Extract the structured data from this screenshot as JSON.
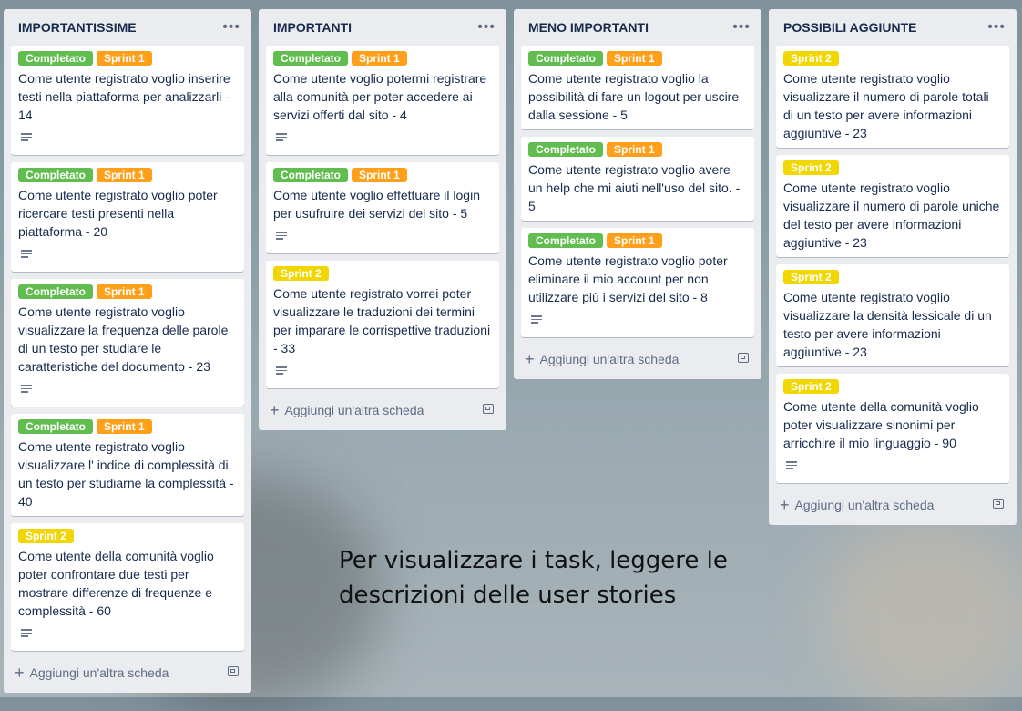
{
  "lists": [
    {
      "title": "IMPORTANTISSIME",
      "cards": [
        {
          "labels": [
            {
              "text": "Completato",
              "color": "#61bd4f"
            },
            {
              "text": "Sprint 1",
              "color": "#ff9f1a"
            }
          ],
          "text": "Come utente registrato voglio inserire testi nella piattaforma per analizzarli - 14",
          "has_description": true
        },
        {
          "labels": [
            {
              "text": "Completato",
              "color": "#61bd4f"
            },
            {
              "text": "Sprint 1",
              "color": "#ff9f1a"
            }
          ],
          "text": "Come utente registrato voglio poter ricercare testi presenti nella piattaforma - 20",
          "has_description": true
        },
        {
          "labels": [
            {
              "text": "Completato",
              "color": "#61bd4f"
            },
            {
              "text": "Sprint 1",
              "color": "#ff9f1a"
            }
          ],
          "text": "Come utente registrato voglio visualizzare la frequenza delle parole di un testo per studiare le caratteristiche del documento - 23",
          "has_description": true
        },
        {
          "labels": [
            {
              "text": "Completato",
              "color": "#61bd4f"
            },
            {
              "text": "Sprint 1",
              "color": "#ff9f1a"
            }
          ],
          "text": "Come utente registrato voglio visualizzare l' indice di complessità di un testo per studiarne la complessità - 40",
          "has_description": false
        },
        {
          "labels": [
            {
              "text": "Sprint 2",
              "color": "#f2d600"
            }
          ],
          "text": "Come utente della comunità voglio poter confrontare due testi per mostrare differenze di frequenze e complessità - 60",
          "has_description": true
        }
      ],
      "add_label": "Aggiungi un'altra scheda"
    },
    {
      "title": "IMPORTANTI",
      "cards": [
        {
          "labels": [
            {
              "text": "Completato",
              "color": "#61bd4f"
            },
            {
              "text": "Sprint 1",
              "color": "#ff9f1a"
            }
          ],
          "text": "Come utente voglio potermi registrare alla comunità per poter accedere ai servizi offerti dal sito - 4",
          "has_description": true
        },
        {
          "labels": [
            {
              "text": "Completato",
              "color": "#61bd4f"
            },
            {
              "text": "Sprint 1",
              "color": "#ff9f1a"
            }
          ],
          "text": "Come utente voglio effettuare il login per usufruire dei servizi del sito - 5",
          "has_description": true
        },
        {
          "labels": [
            {
              "text": "Sprint 2",
              "color": "#f2d600"
            }
          ],
          "text": "Come utente registrato vorrei poter visualizzare le traduzioni dei termini per imparare le corrispettive traduzioni - 33",
          "has_description": true
        }
      ],
      "add_label": "Aggiungi un'altra scheda"
    },
    {
      "title": "MENO IMPORTANTI",
      "cards": [
        {
          "labels": [
            {
              "text": "Completato",
              "color": "#61bd4f"
            },
            {
              "text": "Sprint 1",
              "color": "#ff9f1a"
            }
          ],
          "text": "Come utente registrato voglio la possibilità di fare un logout per uscire dalla sessione - 5",
          "has_description": false
        },
        {
          "labels": [
            {
              "text": "Completato",
              "color": "#61bd4f"
            },
            {
              "text": "Sprint 1",
              "color": "#ff9f1a"
            }
          ],
          "text": "Come utente registrato voglio avere un help che mi aiuti nell'uso del sito. - 5",
          "has_description": false
        },
        {
          "labels": [
            {
              "text": "Completato",
              "color": "#61bd4f"
            },
            {
              "text": "Sprint 1",
              "color": "#ff9f1a"
            }
          ],
          "text": "Come utente registrato voglio poter eliminare il mio account per non utilizzare più i servizi del sito - 8",
          "has_description": true
        }
      ],
      "add_label": "Aggiungi un'altra scheda"
    },
    {
      "title": "POSSIBILI AGGIUNTE",
      "cards": [
        {
          "labels": [
            {
              "text": "Sprint 2",
              "color": "#f2d600"
            }
          ],
          "text": "Come utente registrato voglio visualizzare il numero di parole totali di un testo per avere informazioni aggiuntive - 23",
          "has_description": false
        },
        {
          "labels": [
            {
              "text": "Sprint 2",
              "color": "#f2d600"
            }
          ],
          "text": "Come utente registrato voglio visualizzare il numero di parole uniche del testo per avere informazioni aggiuntive - 23",
          "has_description": false
        },
        {
          "labels": [
            {
              "text": "Sprint 2",
              "color": "#f2d600"
            }
          ],
          "text": "Come utente registrato voglio visualizzare la densità lessicale di un testo per avere informazioni aggiuntive - 23",
          "has_description": false
        },
        {
          "labels": [
            {
              "text": "Sprint 2",
              "color": "#f2d600"
            }
          ],
          "text": "Come utente della comunità voglio poter visualizzare sinonimi per arricchire il mio linguaggio - 90",
          "has_description": true
        }
      ],
      "add_label": "Aggiungi un'altra scheda"
    }
  ],
  "note": {
    "line1": "Per visualizzare i task, leggere le",
    "line2": "descrizioni delle user stories"
  }
}
